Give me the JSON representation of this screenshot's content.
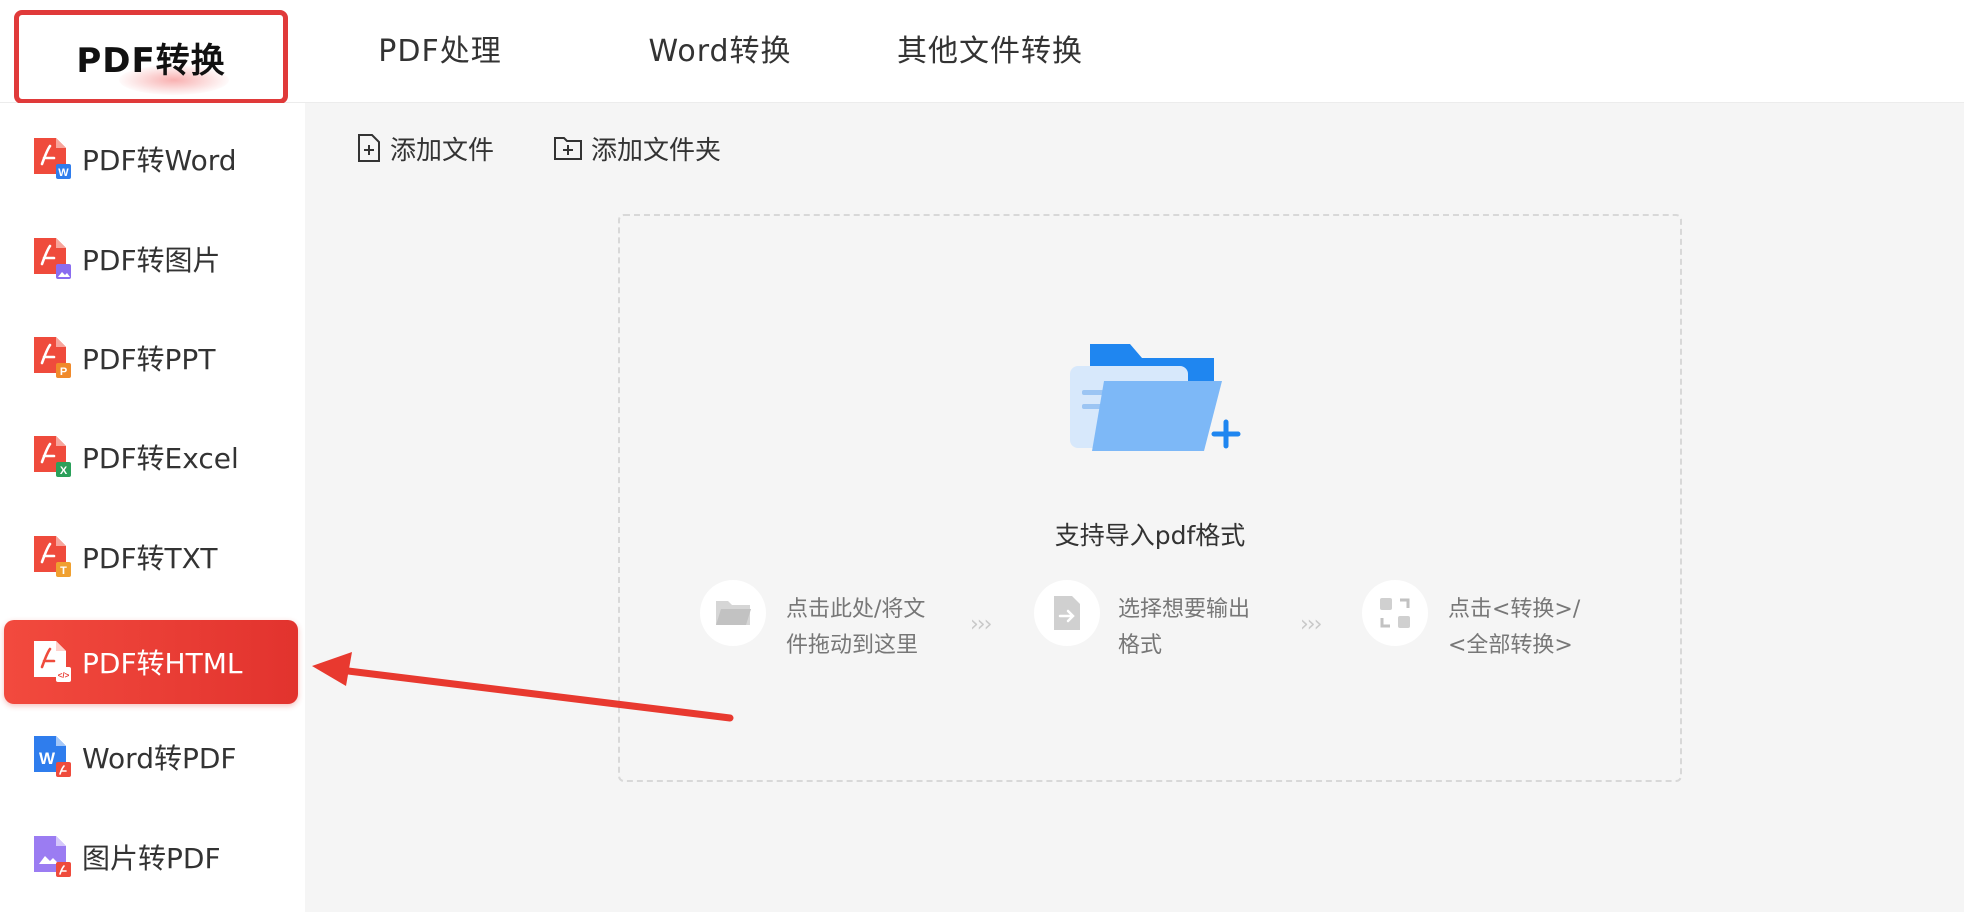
{
  "tabs": [
    {
      "label": "PDF转换",
      "active": true
    },
    {
      "label": "PDF处理"
    },
    {
      "label": "Word转换"
    },
    {
      "label": "其他文件转换"
    }
  ],
  "sidebar": {
    "items": [
      {
        "label": "PDF转Word",
        "badge_color": "#2f7ded",
        "badge_letter": "W"
      },
      {
        "label": "PDF转图片",
        "badge_color": "#8a6cf0",
        "badge_letter": ""
      },
      {
        "label": "PDF转PPT",
        "badge_color": "#f08a2b",
        "badge_letter": "P"
      },
      {
        "label": "PDF转Excel",
        "badge_color": "#2aa05a",
        "badge_letter": "X"
      },
      {
        "label": "PDF转TXT",
        "badge_color": "#f0a030",
        "badge_letter": "T"
      },
      {
        "label": "PDF转HTML",
        "active": true
      },
      {
        "label": "Word转PDF"
      },
      {
        "label": "图片转PDF"
      }
    ]
  },
  "toolbar": {
    "add_file": "添加文件",
    "add_folder": "添加文件夹"
  },
  "dropzone": {
    "hint": "支持导入pdf格式",
    "steps": [
      {
        "line1": "点击此处/将文",
        "line2": "件拖动到这里"
      },
      {
        "line1": "选择想要输出",
        "line2": "格式"
      },
      {
        "line1": "点击<转换>/",
        "line2": "<全部转换>"
      }
    ],
    "arrow": "›››"
  },
  "colors": {
    "accent": "#e8392f",
    "folder_blue": "#1f86f0"
  }
}
